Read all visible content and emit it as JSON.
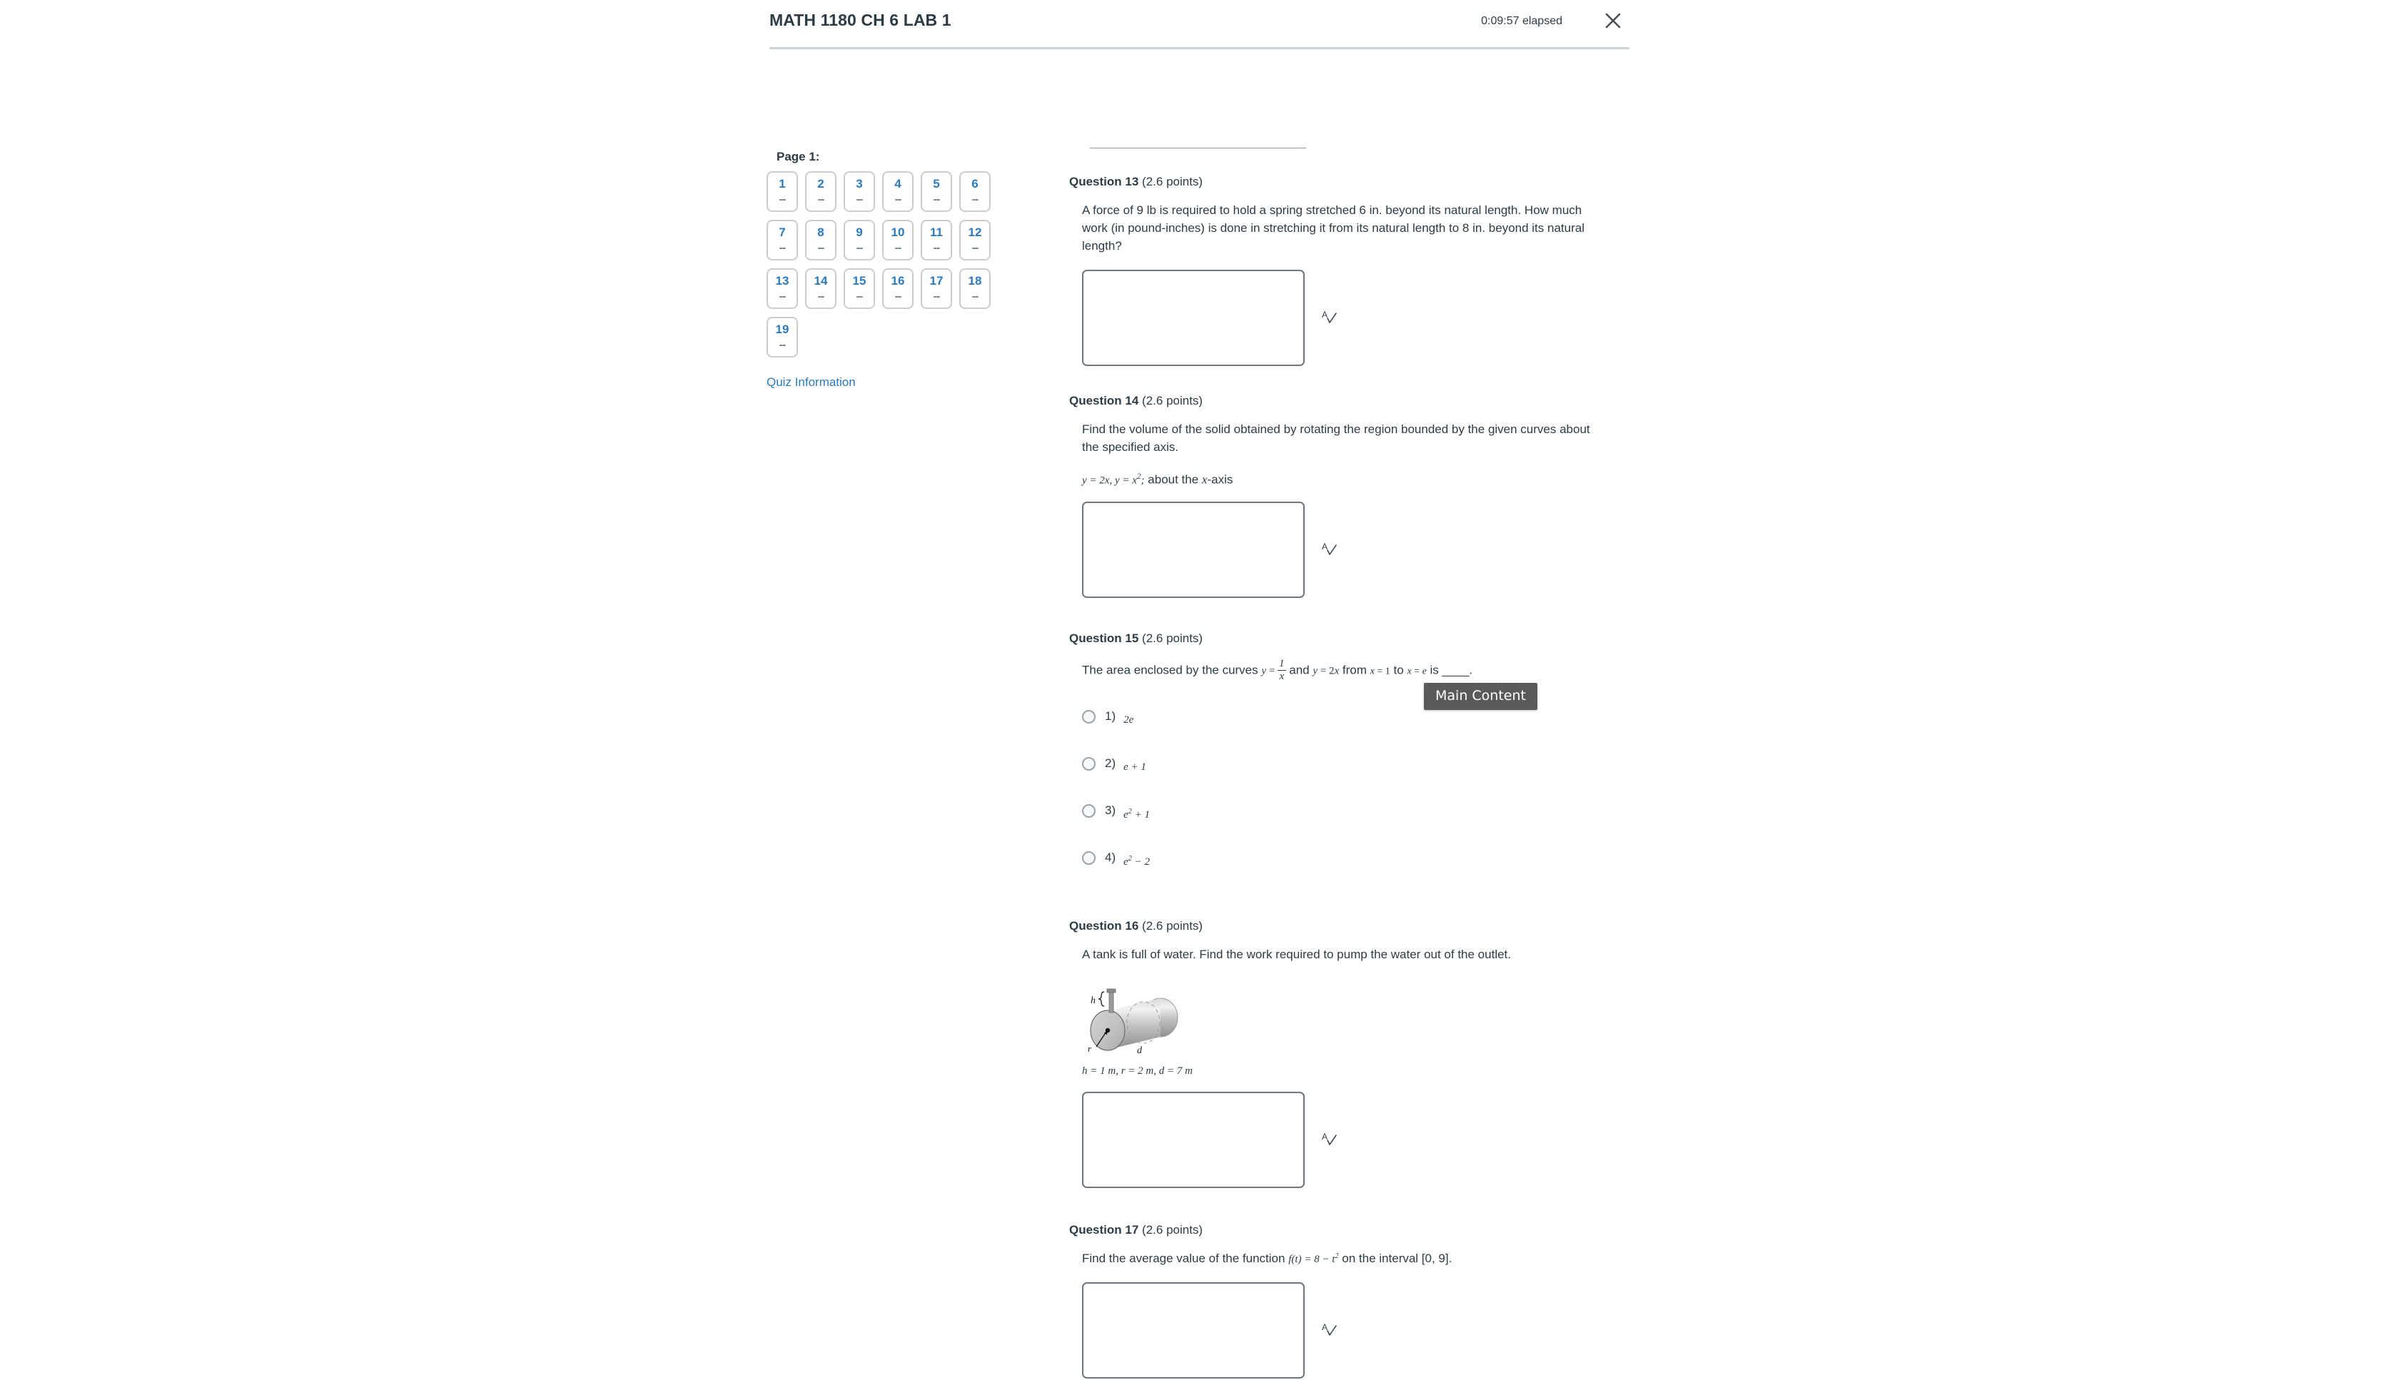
{
  "header": {
    "title": "MATH 1180 CH 6 LAB 1",
    "timer": "0:09:57 elapsed",
    "close_icon": "close-icon"
  },
  "nav": {
    "page_label": "Page 1:",
    "questions": [
      {
        "number": "1",
        "status": "--"
      },
      {
        "number": "2",
        "status": "--"
      },
      {
        "number": "3",
        "status": "--"
      },
      {
        "number": "4",
        "status": "--"
      },
      {
        "number": "5",
        "status": "--"
      },
      {
        "number": "6",
        "status": "--"
      },
      {
        "number": "7",
        "status": "--"
      },
      {
        "number": "8",
        "status": "--"
      },
      {
        "number": "9",
        "status": "--"
      },
      {
        "number": "10",
        "status": "--"
      },
      {
        "number": "11",
        "status": "--"
      },
      {
        "number": "12",
        "status": "--"
      },
      {
        "number": "13",
        "status": "--"
      },
      {
        "number": "14",
        "status": "--"
      },
      {
        "number": "15",
        "status": "--"
      },
      {
        "number": "16",
        "status": "--"
      },
      {
        "number": "17",
        "status": "--"
      },
      {
        "number": "18",
        "status": "--"
      },
      {
        "number": "19",
        "status": "--"
      }
    ],
    "quiz_information_link": "Quiz Information"
  },
  "tooltip": {
    "text": "Main Content"
  },
  "questions": {
    "q13": {
      "label": "Question 13",
      "points": "(2.6 points)",
      "text": "A force of 9 lb is required to hold a spring stretched 6 in. beyond its natural length. How much work (in pound-inches) is done in stretching it from its natural length to 8 in. beyond its natural length?",
      "answer_value": "",
      "spellcheck_icon": "spellcheck-icon"
    },
    "q14": {
      "label": "Question 14",
      "points": "(2.6 points)",
      "text": "Find the volume of the solid obtained by rotating the region bounded by the given curves about the specified axis.",
      "formula": "y = 2x, y = x²; about the x-axis",
      "answer_value": "",
      "spellcheck_icon": "spellcheck-icon"
    },
    "q15": {
      "label": "Question 15",
      "points": "(2.6 points)",
      "text_parts": {
        "lead": "The area enclosed by the curves",
        "curve1": "y = 1/x",
        "mid": "and",
        "curve2": "y = 2x",
        "from_word": "from",
        "lower": "x = 1",
        "to_word": "to",
        "upper": "x = e",
        "tail": "is ____."
      },
      "options": [
        {
          "index": "1)",
          "value": "2e"
        },
        {
          "index": "2)",
          "value": "e + 1"
        },
        {
          "index": "3)",
          "value": "e² + 1"
        },
        {
          "index": "4)",
          "value": "e² − 2"
        }
      ],
      "selected": ""
    },
    "q16": {
      "label": "Question 16",
      "points": "(2.6 points)",
      "text": "A tank is full of water. Find the work required to pump the water out of the outlet.",
      "figure": {
        "name": "horizontal-cylinder-tank-diagram",
        "label_h": "h",
        "label_r": "r",
        "label_d": "d"
      },
      "dimensions": "h = 1 m, r = 2 m, d = 7 m",
      "answer_value": "",
      "spellcheck_icon": "spellcheck-icon"
    },
    "q17": {
      "label": "Question 17",
      "points": "(2.6 points)",
      "text_lead": "Find the average value of the function",
      "formula": "f(t) = 8 − t²",
      "text_tail": "on the interval [0, 9].",
      "answer_value": "",
      "spellcheck_icon": "spellcheck-icon"
    }
  },
  "colors": {
    "link_blue": "#2b7abc",
    "text": "#2d3b45",
    "rule": "#ccd4da",
    "tooltip_bg": "#5a5a5a"
  }
}
